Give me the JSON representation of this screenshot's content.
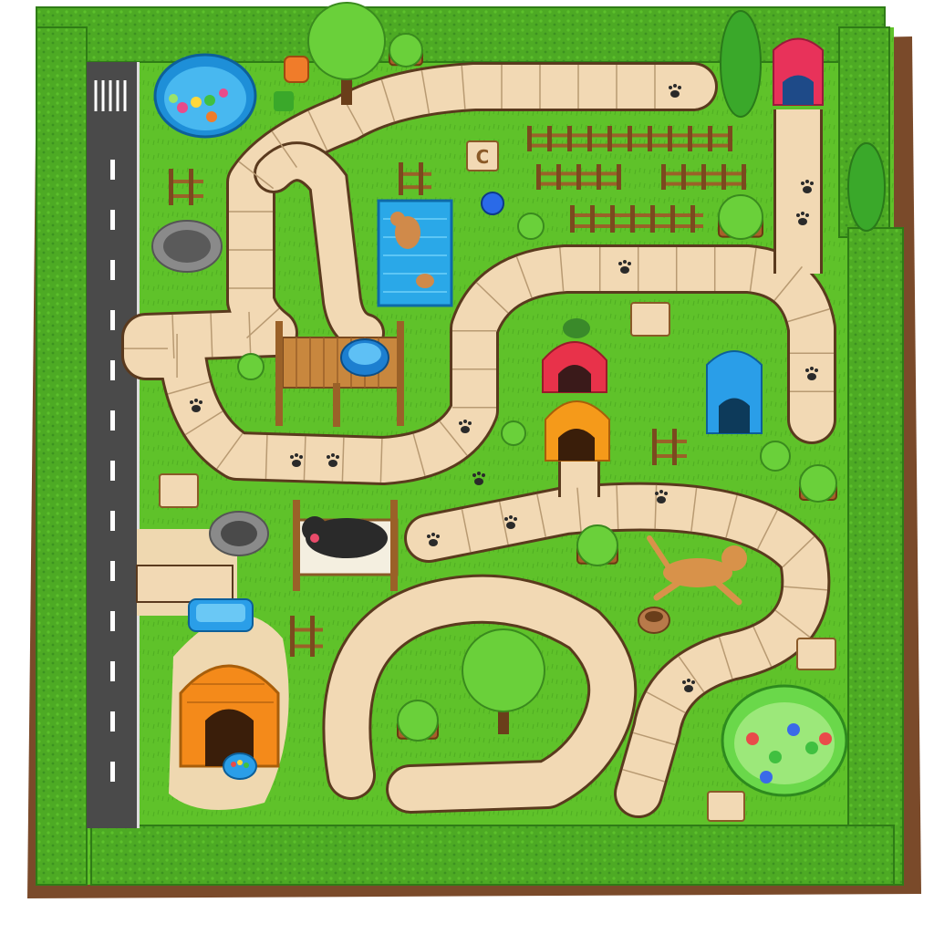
{
  "board": {
    "palette": {
      "grass": "#5fc22a",
      "grass_dark": "#3f9a1c",
      "hedge": "#4daa24",
      "hedge_dark": "#2f7c16",
      "path": "#f2d9b4",
      "path_edge": "#5a3a1e",
      "road": "#4a4a4a",
      "soil": "#7a4a2a",
      "sand": "#efd8b0"
    },
    "tile_markers": [
      {
        "name": "c-tile",
        "label": "C"
      }
    ],
    "pieces": [
      "kiddie-pool",
      "water-bowl",
      "dog-bed",
      "dog-house",
      "tunnel",
      "fence",
      "shrub",
      "tree",
      "paw-print",
      "food-bowl"
    ]
  }
}
